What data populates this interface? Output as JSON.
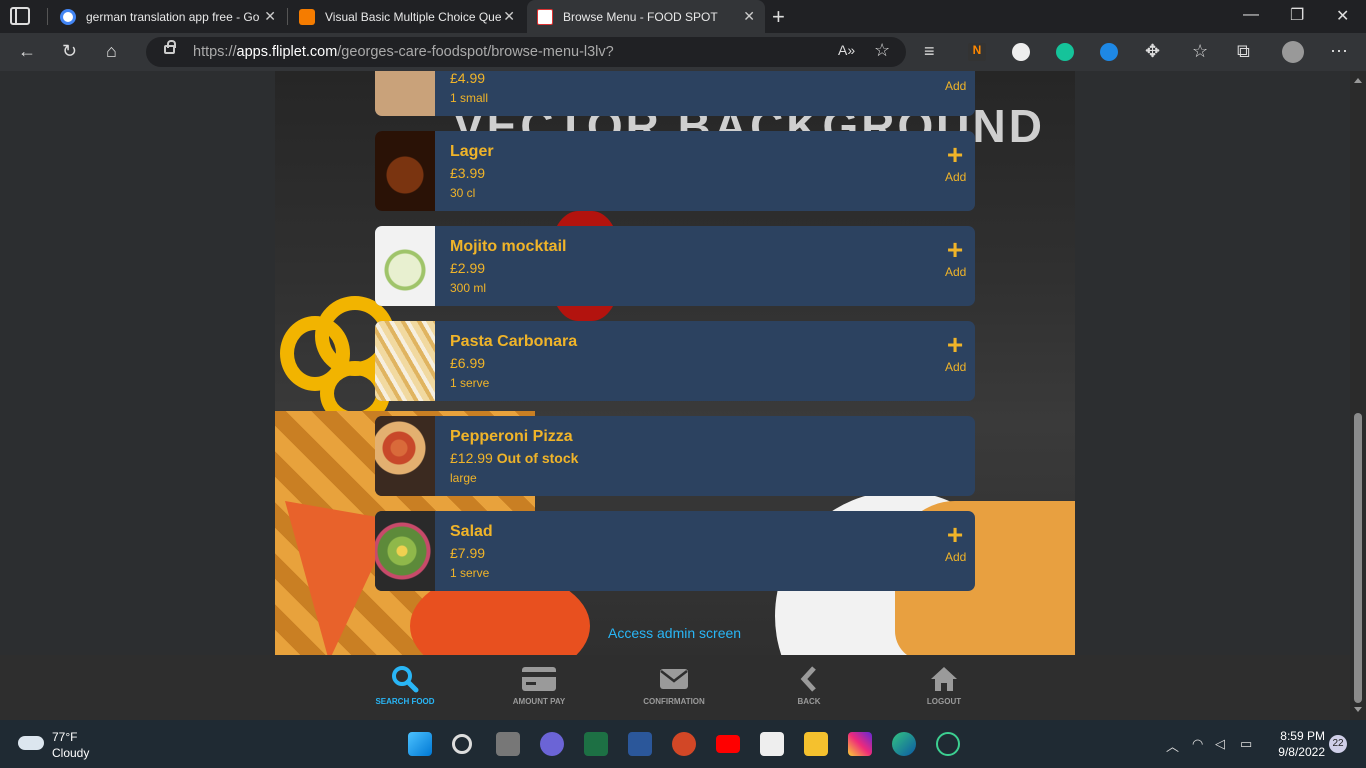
{
  "browser": {
    "tabs": [
      {
        "title": "german translation app free - Go",
        "favicon_color": "#4285f4"
      },
      {
        "title": "Visual Basic Multiple Choice Que",
        "favicon_color": "#f57c00"
      },
      {
        "title": "Browse Menu - FOOD SPOT",
        "favicon_color": "#ffffff",
        "active": true
      }
    ],
    "url_prefix": "https://",
    "url_host": "apps.fliplet.com",
    "url_path": "/georges-care-foodspot/browse-menu-l3lv?"
  },
  "page": {
    "background_text": "VECTOR BACKGROUND",
    "menu_items": [
      {
        "name": "",
        "price": "£4.99",
        "status": "",
        "unit": "1 small",
        "add_label": "Add",
        "has_add": true,
        "thumb_color": "#c9a27a"
      },
      {
        "name": "Lager",
        "price": "£3.99",
        "status": "",
        "unit": "30 cl",
        "add_label": "Add",
        "has_add": true,
        "thumb_color": "#6b2e12"
      },
      {
        "name": "Mojito mocktail",
        "price": "£2.99",
        "status": "",
        "unit": "300 ml",
        "add_label": "Add",
        "has_add": true,
        "thumb_color": "#d9e6c4"
      },
      {
        "name": "Pasta Carbonara",
        "price": "£6.99",
        "status": "",
        "unit": "1 serve",
        "add_label": "Add",
        "has_add": true,
        "thumb_color": "#e6c98a"
      },
      {
        "name": "Pepperoni Pizza",
        "price": "£12.99",
        "status": "Out of stock",
        "unit": "large",
        "add_label": "",
        "has_add": false,
        "thumb_color": "#b8532a"
      },
      {
        "name": "Salad",
        "price": "£7.99",
        "status": "",
        "unit": "1 serve",
        "add_label": "Add",
        "has_add": true,
        "thumb_color": "#5d8a3a"
      }
    ],
    "admin_link": "Access admin screen"
  },
  "app_nav": [
    {
      "label": "SEARCH FOOD",
      "icon": "search-icon",
      "active": true
    },
    {
      "label": "AMOUNT PAY",
      "icon": "credit-card-icon",
      "active": false
    },
    {
      "label": "CONFIRMATION",
      "icon": "envelope-icon",
      "active": false
    },
    {
      "label": "BACK",
      "icon": "chevron-left-icon",
      "active": false
    },
    {
      "label": "LOGOUT",
      "icon": "home-icon",
      "active": false
    }
  ],
  "taskbar": {
    "temp": "77°F",
    "condition": "Cloudy",
    "time": "8:59 PM",
    "date": "9/8/2022",
    "notifications": "22"
  },
  "colors": {
    "accent": "#f0b429",
    "card": "#2c4260",
    "link": "#29b6f6"
  }
}
